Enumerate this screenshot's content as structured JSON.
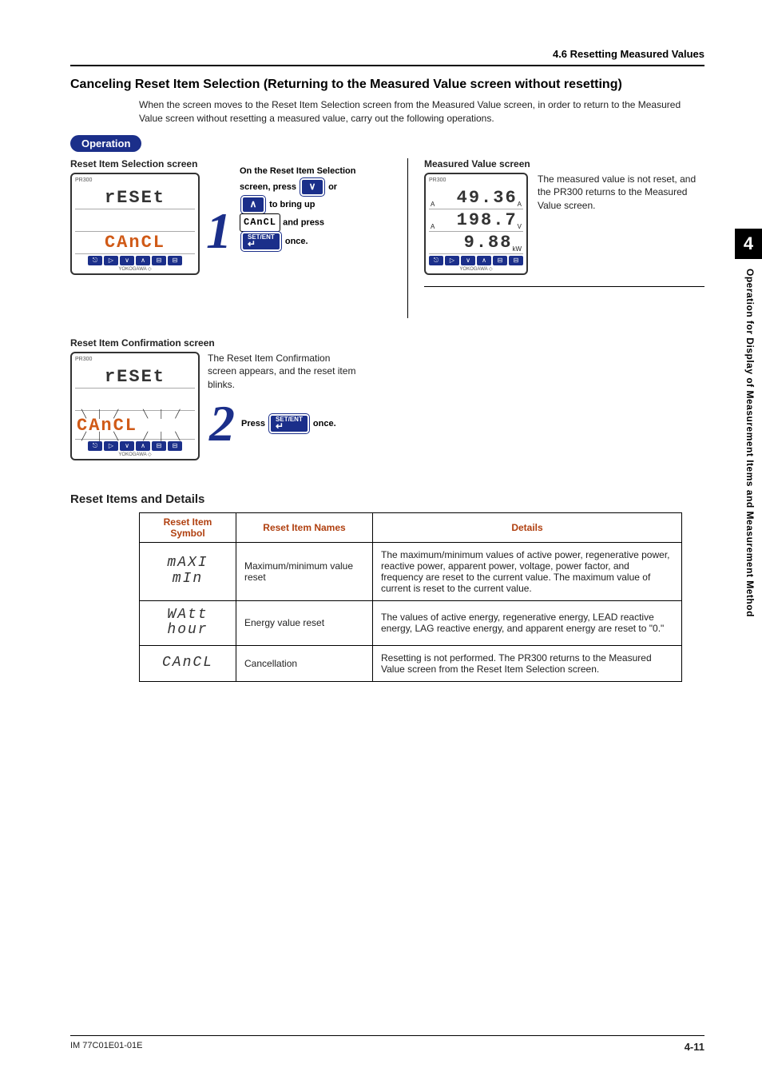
{
  "header": {
    "section": "4.6  Resetting Measured Values"
  },
  "cancel": {
    "title": "Canceling Reset Item Selection (Returning to the Measured Value screen without resetting)",
    "intro": "When the screen moves to the Reset Item Selection screen from the Measured Value screen, in order to return to the Measured Value screen without resetting a measured value, carry out the following operations.",
    "operation_label": "Operation",
    "reset_sel_label": "Reset Item Selection screen",
    "measured_label": "Measured Value screen",
    "step1_num": "1",
    "step1_line1": "On the Reset Item Selection",
    "step1_line2a": "screen, press",
    "step1_line2b": "or",
    "step1_line3": "to bring up",
    "step1_cancl": "CAnCL",
    "step1_line4": "and press",
    "step1_setent": "SET/ENT",
    "step1_once": "once.",
    "measured_note": "The measured value is not reset, and the PR300 returns to the Measured Value screen.",
    "confirm_label": "Reset Item Confirmation screen",
    "confirm_text": "The Reset Item Confirmation screen appears, and the reset item blinks.",
    "step2_num": "2",
    "step2_press": "Press",
    "step2_setent": "SET/ENT",
    "step2_once": "once."
  },
  "lcd": {
    "brand_top": "PR300",
    "row1_reset": "rESEt",
    "row3_cancl": "CAnCL",
    "meas_r1": "49.36",
    "meas_r1u": "A",
    "meas_r2": "198.7",
    "meas_r2u": "V",
    "meas_r3": "9.88",
    "meas_r3u": "kW",
    "brand": "YOKOGAWA ◇"
  },
  "reset_items": {
    "title": "Reset Items and Details",
    "headers": {
      "sym": "Reset Item Symbol",
      "name": "Reset Item Names",
      "det": "Details"
    },
    "rows": [
      {
        "sym1": "mAXI",
        "sym2": "mIn",
        "name": "Maximum/minimum value reset",
        "det": "The maximum/minimum values of active power, regenerative power, reactive power, apparent power, voltage, power factor, and frequency are reset to the current value. The maximum value of current is reset to the current value."
      },
      {
        "sym1": "WAtt",
        "sym2": "hour",
        "name": "Energy value reset",
        "det": "The values of active energy, regenerative energy, LEAD reactive energy, LAG reactive energy, and apparent energy are reset to \"0.\""
      },
      {
        "sym1": "CAnCL",
        "sym2": "",
        "name": "Cancellation",
        "det": "Resetting is not performed. The PR300 returns to the Measured Value screen from the Reset Item Selection screen."
      }
    ]
  },
  "sidebar": {
    "chapter": "4",
    "text": "Operation for Display of Measurement Items and Measurement Method"
  },
  "footer": {
    "doc": "IM 77C01E01-01E",
    "page": "4-11"
  }
}
